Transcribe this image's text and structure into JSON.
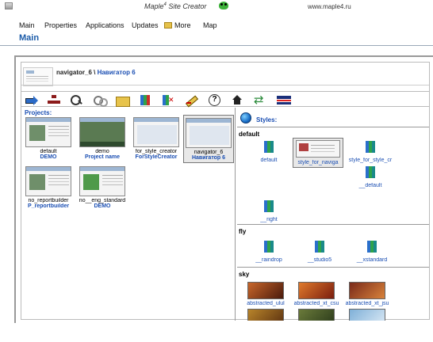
{
  "window": {
    "title": "Maple",
    "title_superscript": "4",
    "title_suffix": " Site Creator",
    "url": "www.maple4.ru"
  },
  "menu": {
    "items": [
      "Main",
      "Properties",
      "Applications",
      "Updates",
      "More",
      "Map"
    ]
  },
  "page": {
    "title": "Main"
  },
  "breadcrumb": {
    "path": "navigator_6 \\ ",
    "current": "Навигатор 6"
  },
  "toolbar": {
    "icons": [
      "back-arrow-icon",
      "tree-icon",
      "magnifier-icon",
      "gears-icon",
      "folder-icon",
      "books-icon",
      "delete-book-icon",
      "edit-pencil-icon",
      "help-icon",
      "home-icon",
      "swap-icon",
      "uk-flag-icon"
    ]
  },
  "projects": {
    "title": "Projects:",
    "items": [
      {
        "name": "default",
        "subtitle": "DEMO"
      },
      {
        "name": "demo",
        "subtitle": "Project name"
      },
      {
        "name": "for_style_creator",
        "subtitle": "ForStyleCreator"
      },
      {
        "name": "navigator_6",
        "subtitle": "Навигатор 6",
        "selected": true
      },
      {
        "name": "no_reportbuilder",
        "subtitle": "P_reportbuilder"
      },
      {
        "name": "no__eng_standard",
        "subtitle": "DEMO"
      }
    ]
  },
  "styles": {
    "title": "Styles:",
    "groups": [
      {
        "name": "default",
        "items": [
          "default",
          "style_for_naviga",
          "style_for_style_cr",
          "__default",
          "__right"
        ]
      },
      {
        "name": "fly",
        "items": [
          "__raindrop",
          "__studio5",
          "__xstandard"
        ]
      },
      {
        "name": "sky",
        "items": [
          "abstracted_ulul",
          "abstracted_xt_csu",
          "abstracted_xt_jsu"
        ]
      }
    ]
  }
}
